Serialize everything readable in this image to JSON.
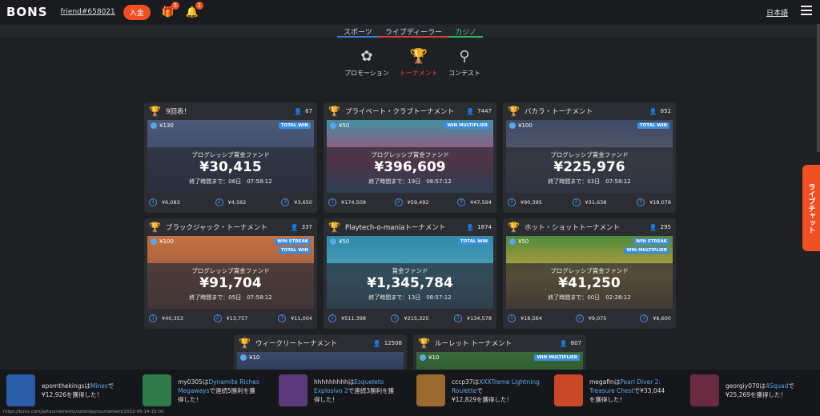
{
  "header": {
    "logo": "BONS",
    "friend": "friend#658021",
    "deposit_label": "入金",
    "gift_badge": "5",
    "bell_badge": "1",
    "language": "日本語"
  },
  "sports_tabs": [
    "スポーツ",
    "ライブディーラー",
    "カジノ"
  ],
  "subnav": [
    {
      "label": "プロモーション",
      "icon": "promo-icon"
    },
    {
      "label": "トーナメント",
      "icon": "trophy-icon"
    },
    {
      "label": "コンテスト",
      "icon": "pin-icon"
    }
  ],
  "cards": [
    {
      "title": "9回表！",
      "players": "67",
      "bet": "¥130",
      "tags": [
        "TOTAL WIN"
      ],
      "fund_label": "プログレッシブ賞金ファンド",
      "amount": "¥30,415",
      "ends": "終了時間まで：06日　07:58:12",
      "prizes": [
        "¥6,083",
        "¥4,562",
        "¥3,650"
      ]
    },
    {
      "title": "プライベート・クラブトーナメント",
      "players": "7447",
      "bet": "¥50",
      "tags": [
        "WIN MULTIPLIER"
      ],
      "fund_label": "プログレッシブ賞金ファンド",
      "amount": "¥396,609",
      "ends": "終了時間まで：19日　08:57:12",
      "prizes": [
        "¥174,509",
        "¥59,492",
        "¥47,594"
      ]
    },
    {
      "title": "バカラ・トーナメント",
      "players": "852",
      "bet": "¥100",
      "tags": [
        "TOTAL WIN"
      ],
      "fund_label": "プログレッシブ賞金ファンド",
      "amount": "¥225,976",
      "ends": "終了時間まで：03日　07:58:12",
      "prizes": [
        "¥90,395",
        "¥31,638",
        "¥18,078"
      ]
    },
    {
      "title": "ブラックジャック・トーナメント",
      "players": "337",
      "bet": "¥100",
      "tags": [
        "WIN STREAK",
        "TOTAL WIN"
      ],
      "fund_label": "プログレッシブ賞金ファンド",
      "amount": "¥91,704",
      "ends": "終了時間まで：05日　07:58:12",
      "prizes": [
        "¥40,353",
        "¥13,757",
        "¥11,004"
      ]
    },
    {
      "title": "Playtech-o-maniaトーナメント",
      "players": "1874",
      "bet": "¥50",
      "tags": [
        "TOTAL WIN"
      ],
      "fund_label": "賞金ファンド",
      "amount": "¥1,345,784",
      "ends": "終了時間まで：13日　08:57:12",
      "prizes": [
        "¥511,398",
        "¥215,325",
        "¥134,578"
      ]
    },
    {
      "title": "ホット・ショットトーナメント",
      "players": "295",
      "bet": "¥50",
      "tags": [
        "WIN STREAK",
        "WIN MULTIPLIER"
      ],
      "fund_label": "プログレッシブ賞金ファンド",
      "amount": "¥41,250",
      "ends": "終了時間まで：00日　02:28:12",
      "prizes": [
        "¥18,564",
        "¥9,075",
        "¥6,600"
      ]
    },
    {
      "title": "ウィークリートーナメント",
      "players": "12508",
      "bet": "¥10",
      "tags": [],
      "fund_label": "",
      "amount": "",
      "ends": "",
      "prizes": []
    },
    {
      "title": "ルーレット トーナメント",
      "players": "807",
      "bet": "¥10",
      "tags": [
        "WIN MULTIPLIER"
      ],
      "fund_label": "",
      "amount": "",
      "ends": "",
      "prizes": []
    }
  ],
  "livechat": "ライブチャット",
  "ticker": [
    {
      "user": "epomthekingsは",
      "game": "Mines",
      "tail1": "で",
      "line2": "¥12,926を獲得した！"
    },
    {
      "user": "my0305は",
      "game": "Dynamite Riches Megaways",
      "tail1": "で連続5勝利を獲",
      "line2": "得した！"
    },
    {
      "user": "hhhhhhhhhは",
      "game": "Esqueleto Explosivo 2",
      "tail1": "で連続3勝利を獲",
      "line2": "得した！"
    },
    {
      "user": "cccp37は",
      "game": "XXXTreme Lightning Roulette",
      "tail1": "で",
      "line2": "¥12,829を獲得した！"
    },
    {
      "user": "megafinは",
      "game": "Pearl Diver 2: Treasure Chest",
      "tail1": "で¥33,044",
      "line2": "を獲得した！"
    },
    {
      "user": "georgiy070は",
      "game": "4Squad",
      "tail1": "で",
      "line2": "¥25,269を獲得した！"
    }
  ],
  "status_url": "https://bons.com/ja/tournaments/saturdaytournament/2022-05-14-15-00"
}
